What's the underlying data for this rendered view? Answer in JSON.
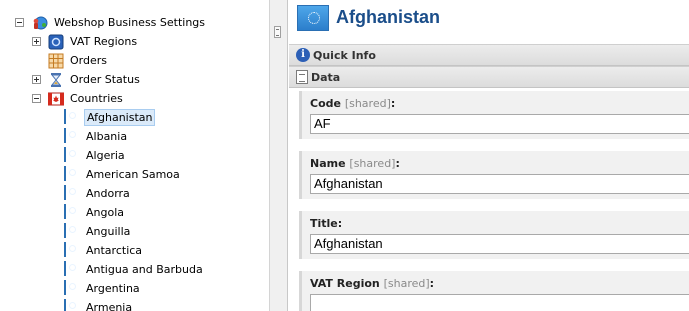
{
  "tree": {
    "root": {
      "label": "Webshop Business Settings",
      "icon": "globe-people-icon"
    },
    "nodes": [
      {
        "label": "VAT Regions",
        "icon": "vat-regions-icon",
        "expander": "plus"
      },
      {
        "label": "Orders",
        "icon": "orders-grid-icon"
      },
      {
        "label": "Order Status",
        "icon": "hourglass-icon",
        "expander": "plus"
      },
      {
        "label": "Countries",
        "icon": "canada-flag-icon",
        "expander": "minus"
      }
    ],
    "countries": [
      {
        "label": "Afghanistan",
        "selected": true
      },
      {
        "label": "Albania"
      },
      {
        "label": "Algeria"
      },
      {
        "label": "American Samoa"
      },
      {
        "label": "Andorra"
      },
      {
        "label": "Angola"
      },
      {
        "label": "Anguilla"
      },
      {
        "label": "Antarctica"
      },
      {
        "label": "Antigua and Barbuda"
      },
      {
        "label": "Argentina"
      },
      {
        "label": "Armenia"
      }
    ]
  },
  "content": {
    "title": "Afghanistan",
    "sections": {
      "quick_info": "Quick Info",
      "data": "Data"
    },
    "fields": [
      {
        "label": "Code",
        "shared": "[shared]",
        "colon": ":",
        "value": "AF"
      },
      {
        "label": "Name",
        "shared": "[shared]",
        "colon": ":",
        "value": "Afghanistan"
      },
      {
        "label": "Title",
        "shared": "",
        "colon": ":",
        "value": "Afghanistan"
      },
      {
        "label": "VAT Region",
        "shared": "[shared]",
        "colon": ":",
        "value": ""
      }
    ]
  },
  "colors": {
    "title": "#1b4e8a",
    "selection": "#dbeaf9"
  }
}
